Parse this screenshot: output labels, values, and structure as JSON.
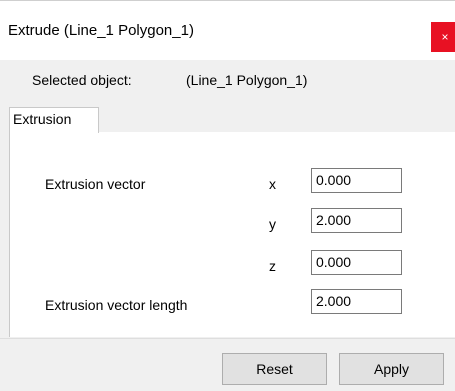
{
  "window": {
    "title": "Extrude (Line_1 Polygon_1)"
  },
  "close_icon": "×",
  "selected": {
    "label": "Selected object:",
    "value": "(Line_1 Polygon_1)"
  },
  "tabs": [
    {
      "label": "Extrusion"
    }
  ],
  "extrusion": {
    "vector_label": "Extrusion vector",
    "x_label": "x",
    "x_value": "0.000",
    "y_label": "y",
    "y_value": "2.000",
    "z_label": "z",
    "z_value": "0.000",
    "length_label": "Extrusion vector length",
    "length_value": "2.000"
  },
  "buttons": {
    "reset": "Reset",
    "apply": "Apply"
  }
}
